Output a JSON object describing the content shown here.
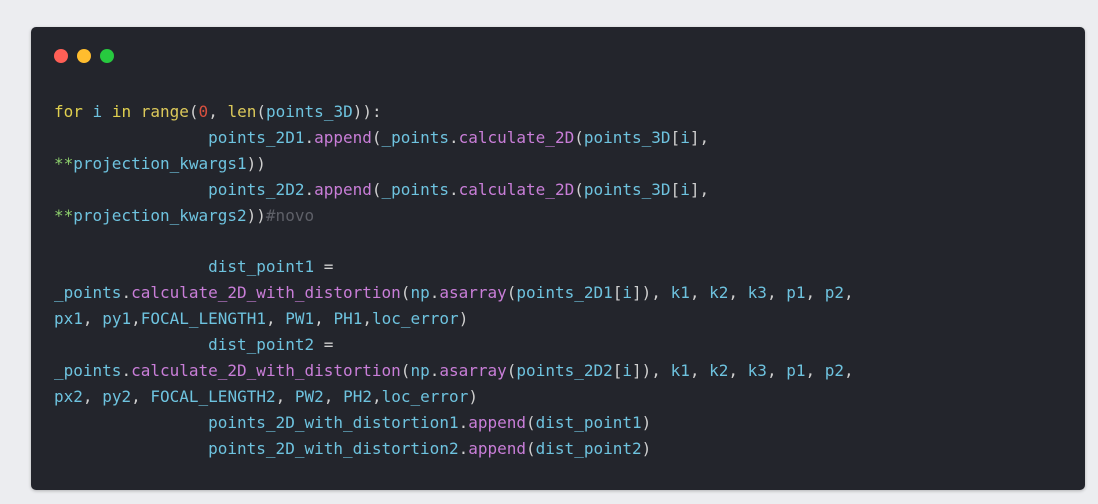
{
  "window": {
    "traffic_lights": [
      {
        "name": "close",
        "color": "#ff5f56"
      },
      {
        "name": "minimize",
        "color": "#ffbd2e"
      },
      {
        "name": "zoom",
        "color": "#27c93f"
      }
    ]
  },
  "colors": {
    "keyword": "#e0d04f",
    "builtin": "#dcc95a",
    "number": "#d9503f",
    "identifier": "#6ec3df",
    "method": "#c97ed8",
    "operator": "#8ed16d",
    "comment": "#5e6068",
    "punctuation": "#cfcfcf"
  },
  "code": {
    "lines": [
      [
        [
          "keyword",
          "for"
        ],
        [
          "plain",
          " "
        ],
        [
          "identifier",
          "i"
        ],
        [
          "plain",
          " "
        ],
        [
          "keyword",
          "in"
        ],
        [
          "plain",
          " "
        ],
        [
          "builtin",
          "range"
        ],
        [
          "punctuation",
          "("
        ],
        [
          "number",
          "0"
        ],
        [
          "punctuation",
          ","
        ],
        [
          "plain",
          " "
        ],
        [
          "builtin",
          "len"
        ],
        [
          "punctuation",
          "("
        ],
        [
          "identifier",
          "points_3D"
        ],
        [
          "punctuation",
          "))"
        ],
        [
          "punctuation",
          ":"
        ]
      ],
      [
        [
          "plain",
          "                "
        ],
        [
          "identifier",
          "points_2D1"
        ],
        [
          "punctuation",
          "."
        ],
        [
          "method",
          "append"
        ],
        [
          "punctuation",
          "("
        ],
        [
          "identifier",
          "_points"
        ],
        [
          "punctuation",
          "."
        ],
        [
          "method",
          "calculate_2D"
        ],
        [
          "punctuation",
          "("
        ],
        [
          "identifier",
          "points_3D"
        ],
        [
          "punctuation",
          "["
        ],
        [
          "identifier",
          "i"
        ],
        [
          "punctuation",
          "],"
        ]
      ],
      [
        [
          "operator",
          "**"
        ],
        [
          "identifier",
          "projection_kwargs1"
        ],
        [
          "punctuation",
          "))"
        ]
      ],
      [
        [
          "plain",
          "                "
        ],
        [
          "identifier",
          "points_2D2"
        ],
        [
          "punctuation",
          "."
        ],
        [
          "method",
          "append"
        ],
        [
          "punctuation",
          "("
        ],
        [
          "identifier",
          "_points"
        ],
        [
          "punctuation",
          "."
        ],
        [
          "method",
          "calculate_2D"
        ],
        [
          "punctuation",
          "("
        ],
        [
          "identifier",
          "points_3D"
        ],
        [
          "punctuation",
          "["
        ],
        [
          "identifier",
          "i"
        ],
        [
          "punctuation",
          "],"
        ]
      ],
      [
        [
          "operator",
          "**"
        ],
        [
          "identifier",
          "projection_kwargs2"
        ],
        [
          "punctuation",
          "))"
        ],
        [
          "comment",
          "#novo"
        ]
      ],
      [],
      [
        [
          "plain",
          "                "
        ],
        [
          "identifier",
          "dist_point1"
        ],
        [
          "plain",
          " "
        ],
        [
          "punctuation",
          "="
        ]
      ],
      [
        [
          "identifier",
          "_points"
        ],
        [
          "punctuation",
          "."
        ],
        [
          "method",
          "calculate_2D_with_distortion"
        ],
        [
          "punctuation",
          "("
        ],
        [
          "identifier",
          "np"
        ],
        [
          "punctuation",
          "."
        ],
        [
          "method",
          "asarray"
        ],
        [
          "punctuation",
          "("
        ],
        [
          "identifier",
          "points_2D1"
        ],
        [
          "punctuation",
          "["
        ],
        [
          "identifier",
          "i"
        ],
        [
          "punctuation",
          "]),"
        ],
        [
          "plain",
          " "
        ],
        [
          "identifier",
          "k1"
        ],
        [
          "punctuation",
          ","
        ],
        [
          "plain",
          " "
        ],
        [
          "identifier",
          "k2"
        ],
        [
          "punctuation",
          ","
        ],
        [
          "plain",
          " "
        ],
        [
          "identifier",
          "k3"
        ],
        [
          "punctuation",
          ","
        ],
        [
          "plain",
          " "
        ],
        [
          "identifier",
          "p1"
        ],
        [
          "punctuation",
          ","
        ],
        [
          "plain",
          " "
        ],
        [
          "identifier",
          "p2"
        ],
        [
          "punctuation",
          ","
        ]
      ],
      [
        [
          "identifier",
          "px1"
        ],
        [
          "punctuation",
          ","
        ],
        [
          "plain",
          " "
        ],
        [
          "identifier",
          "py1"
        ],
        [
          "punctuation",
          ","
        ],
        [
          "identifier",
          "FOCAL_LENGTH1"
        ],
        [
          "punctuation",
          ","
        ],
        [
          "plain",
          " "
        ],
        [
          "identifier",
          "PW1"
        ],
        [
          "punctuation",
          ","
        ],
        [
          "plain",
          " "
        ],
        [
          "identifier",
          "PH1"
        ],
        [
          "punctuation",
          ","
        ],
        [
          "identifier",
          "loc_error"
        ],
        [
          "punctuation",
          ")"
        ]
      ],
      [
        [
          "plain",
          "                "
        ],
        [
          "identifier",
          "dist_point2"
        ],
        [
          "plain",
          " "
        ],
        [
          "punctuation",
          "="
        ]
      ],
      [
        [
          "identifier",
          "_points"
        ],
        [
          "punctuation",
          "."
        ],
        [
          "method",
          "calculate_2D_with_distortion"
        ],
        [
          "punctuation",
          "("
        ],
        [
          "identifier",
          "np"
        ],
        [
          "punctuation",
          "."
        ],
        [
          "method",
          "asarray"
        ],
        [
          "punctuation",
          "("
        ],
        [
          "identifier",
          "points_2D2"
        ],
        [
          "punctuation",
          "["
        ],
        [
          "identifier",
          "i"
        ],
        [
          "punctuation",
          "]),"
        ],
        [
          "plain",
          " "
        ],
        [
          "identifier",
          "k1"
        ],
        [
          "punctuation",
          ","
        ],
        [
          "plain",
          " "
        ],
        [
          "identifier",
          "k2"
        ],
        [
          "punctuation",
          ","
        ],
        [
          "plain",
          " "
        ],
        [
          "identifier",
          "k3"
        ],
        [
          "punctuation",
          ","
        ],
        [
          "plain",
          " "
        ],
        [
          "identifier",
          "p1"
        ],
        [
          "punctuation",
          ","
        ],
        [
          "plain",
          " "
        ],
        [
          "identifier",
          "p2"
        ],
        [
          "punctuation",
          ","
        ]
      ],
      [
        [
          "identifier",
          "px2"
        ],
        [
          "punctuation",
          ","
        ],
        [
          "plain",
          " "
        ],
        [
          "identifier",
          "py2"
        ],
        [
          "punctuation",
          ","
        ],
        [
          "plain",
          " "
        ],
        [
          "identifier",
          "FOCAL_LENGTH2"
        ],
        [
          "punctuation",
          ","
        ],
        [
          "plain",
          " "
        ],
        [
          "identifier",
          "PW2"
        ],
        [
          "punctuation",
          ","
        ],
        [
          "plain",
          " "
        ],
        [
          "identifier",
          "PH2"
        ],
        [
          "punctuation",
          ","
        ],
        [
          "identifier",
          "loc_error"
        ],
        [
          "punctuation",
          ")"
        ]
      ],
      [
        [
          "plain",
          "                "
        ],
        [
          "identifier",
          "points_2D_with_distortion1"
        ],
        [
          "punctuation",
          "."
        ],
        [
          "method",
          "append"
        ],
        [
          "punctuation",
          "("
        ],
        [
          "identifier",
          "dist_point1"
        ],
        [
          "punctuation",
          ")"
        ]
      ],
      [
        [
          "plain",
          "                "
        ],
        [
          "identifier",
          "points_2D_with_distortion2"
        ],
        [
          "punctuation",
          "."
        ],
        [
          "method",
          "append"
        ],
        [
          "punctuation",
          "("
        ],
        [
          "identifier",
          "dist_point2"
        ],
        [
          "punctuation",
          ")"
        ]
      ]
    ]
  }
}
